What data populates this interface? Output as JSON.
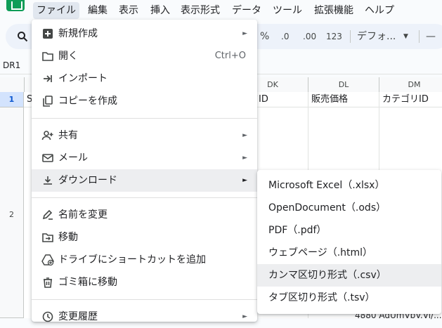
{
  "menubar": {
    "items": [
      "ファイル",
      "編集",
      "表示",
      "挿入",
      "表示形式",
      "データ",
      "ツール",
      "拡張機能",
      "ヘルプ"
    ]
  },
  "toolbar": {
    "percent": "%",
    "decimal_decrease": ".0",
    "decimal_increase": ".00",
    "number_format": "123",
    "font_name": "デフォ...",
    "minus": "—"
  },
  "name_box": "DR1",
  "grid": {
    "columns": [
      "DK",
      "DL",
      "DM"
    ],
    "rows": [
      "1",
      "2"
    ],
    "row1": [
      "ンドID",
      "販売価格",
      "カテゴリID"
    ],
    "row1_first_col_fragment": "S",
    "bottom_fragment": "4880 AdUmVbV.Vi/..."
  },
  "file_menu": {
    "items": [
      {
        "label": "新規作成",
        "icon": "plus-box-icon",
        "submenu": true
      },
      {
        "label": "開く",
        "icon": "folder-icon",
        "shortcut": "Ctrl+O"
      },
      {
        "label": "インポート",
        "icon": "import-arrow-icon"
      },
      {
        "label": "コピーを作成",
        "icon": "copy-icon"
      },
      {
        "label": "共有",
        "icon": "person-add-icon",
        "submenu": true
      },
      {
        "label": "メール",
        "icon": "mail-icon",
        "submenu": true
      },
      {
        "label": "ダウンロード",
        "icon": "download-icon",
        "submenu": true,
        "highlighted": true
      },
      {
        "label": "名前を変更",
        "icon": "rename-icon"
      },
      {
        "label": "移動",
        "icon": "move-folder-icon"
      },
      {
        "label": "ドライブにショートカットを追加",
        "icon": "drive-shortcut-icon"
      },
      {
        "label": "ゴミ箱に移動",
        "icon": "trash-icon"
      },
      {
        "label": "変更履歴",
        "icon": "history-icon",
        "submenu": true
      }
    ]
  },
  "download_submenu": {
    "items": [
      "Microsoft Excel（.xlsx）",
      "OpenDocument（.ods）",
      "PDF（.pdf）",
      "ウェブページ（.html）",
      "カンマ区切り形式（.csv）",
      "タブ区切り形式（.tsv）"
    ],
    "highlighted_index": 4
  },
  "colors": {
    "accent": "#0b57d0",
    "sheets_green": "#0f9d58",
    "hover": "#edeef0"
  }
}
